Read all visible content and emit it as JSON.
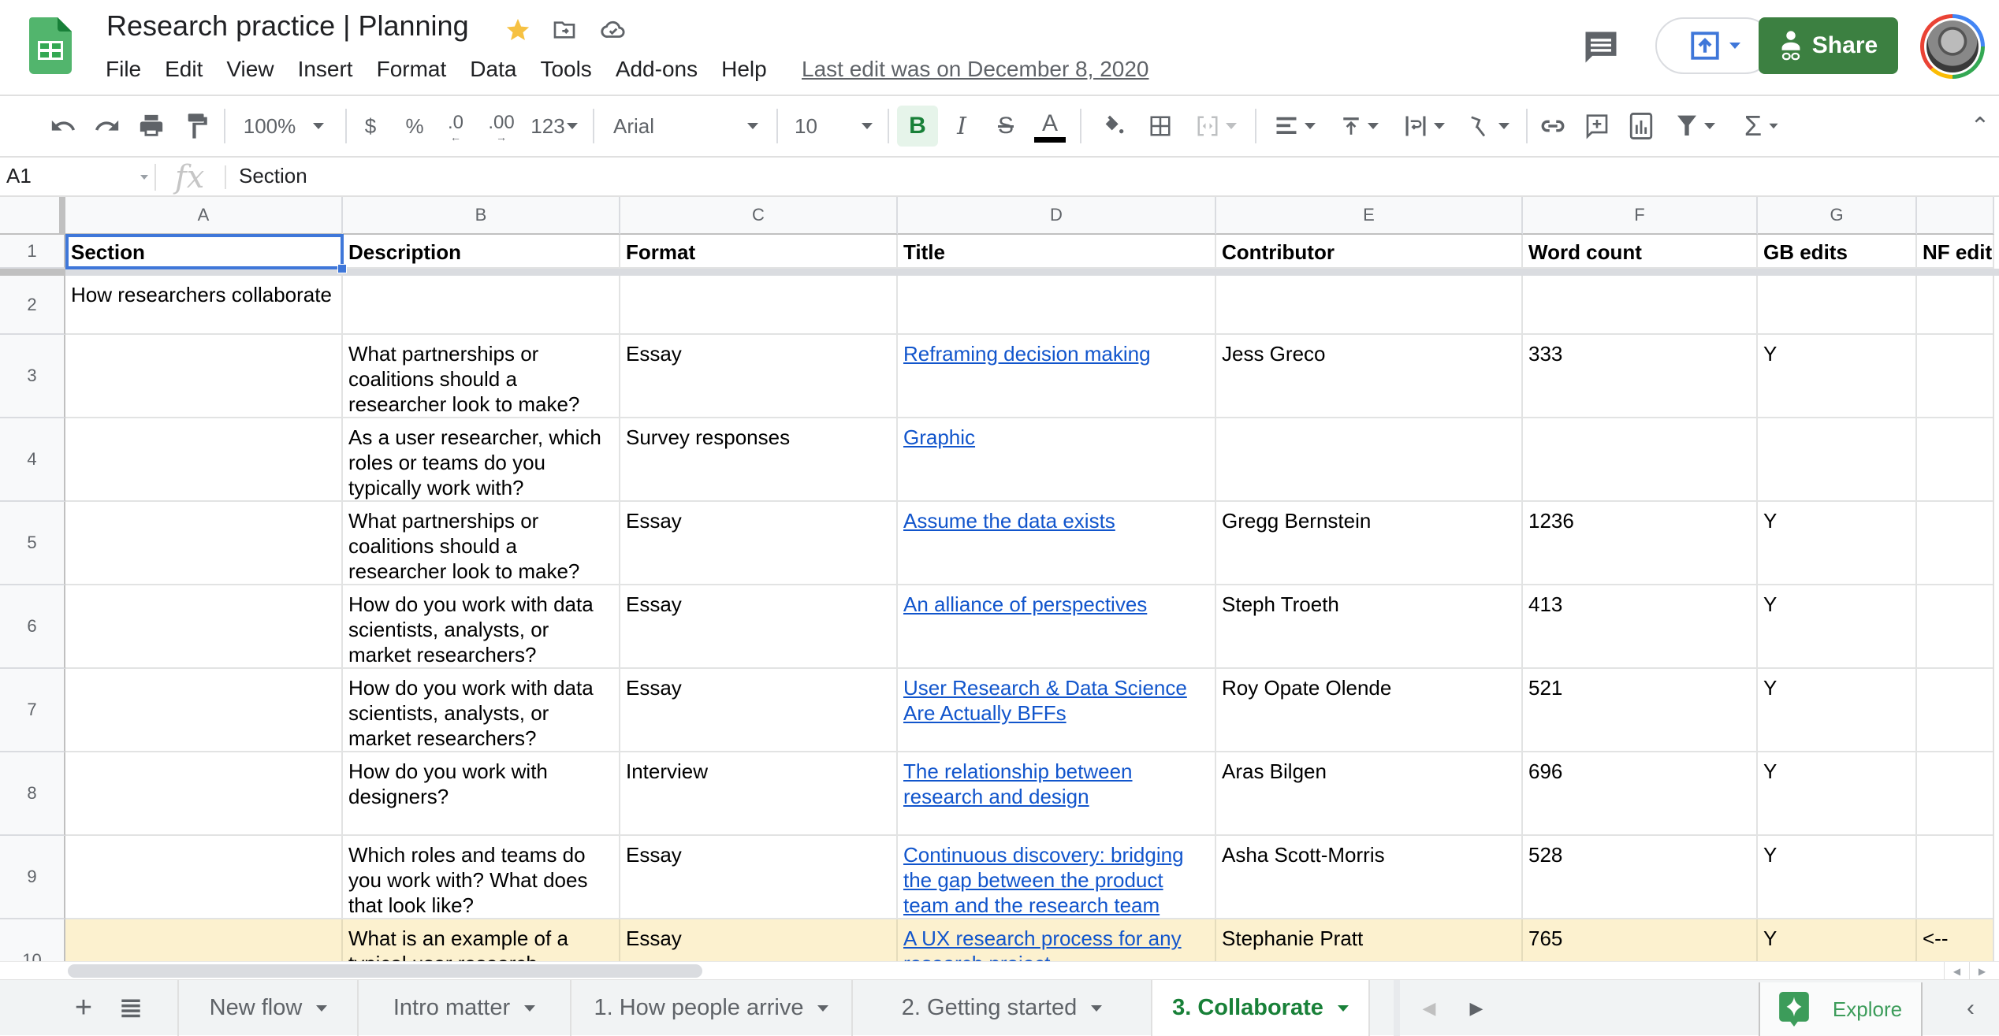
{
  "app": {
    "title": "Research practice | Planning",
    "last_edit": "Last edit was on December 8, 2020",
    "share_label": "Share",
    "colors": {
      "brand_green": "#3c8041",
      "link_blue": "#1155cc",
      "selection_blue": "#3f77d9",
      "highlight_row": "#fcf1cf",
      "active_tab_green": "#188038"
    }
  },
  "menu": [
    "File",
    "Edit",
    "View",
    "Insert",
    "Format",
    "Data",
    "Tools",
    "Add-ons",
    "Help"
  ],
  "toolbar": {
    "zoom": "100%",
    "currency": "$",
    "percent": "%",
    "decrease_decimal": ".0",
    "increase_decimal": ".00",
    "more_formats": "123",
    "font": "Arial",
    "font_size": "10",
    "bold": "B",
    "italic": "I",
    "strikethrough": "S",
    "text_color": "A"
  },
  "formula_bar": {
    "cell_ref": "A1",
    "fx": "fx",
    "value": "Section"
  },
  "grid": {
    "columns": [
      "A",
      "B",
      "C",
      "D",
      "E",
      "F",
      "G",
      ""
    ],
    "row_numbers": [
      "1",
      "2",
      "3",
      "4",
      "5",
      "6",
      "7",
      "8",
      "9",
      "10"
    ],
    "header_row": [
      "Section",
      "Description",
      "Format",
      "Title",
      "Contributor",
      "Word count",
      "GB edits",
      "NF edit"
    ],
    "rows": [
      {
        "section": "How researchers collaborate",
        "description": "",
        "format": "",
        "title": "",
        "contributor": "",
        "word_count": "",
        "gb_edits": "",
        "nf_edits": ""
      },
      {
        "section": "",
        "description": "What partnerships or coalitions should a researcher look to make?",
        "format": "Essay",
        "title": "Reframing decision making",
        "contributor": "Jess Greco",
        "word_count": "333",
        "gb_edits": "Y",
        "nf_edits": ""
      },
      {
        "section": "",
        "description": "As a user researcher, which roles or teams do you typically work with?",
        "format": "Survey responses",
        "title": "Graphic",
        "contributor": "",
        "word_count": "",
        "gb_edits": "",
        "nf_edits": ""
      },
      {
        "section": "",
        "description": "What partnerships or coalitions should a researcher look to make?",
        "format": "Essay",
        "title": "Assume the data exists",
        "contributor": "Gregg Bernstein",
        "word_count": "1236",
        "gb_edits": "Y",
        "nf_edits": ""
      },
      {
        "section": "",
        "description": "How do you work with data scientists, analysts, or market researchers?",
        "format": "Essay",
        "title": "An alliance of perspectives",
        "contributor": "Steph Troeth",
        "word_count": "413",
        "gb_edits": "Y",
        "nf_edits": ""
      },
      {
        "section": "",
        "description": "How do you work with data scientists, analysts, or market researchers?",
        "format": "Essay",
        "title": "User Research & Data Science Are Actually BFFs",
        "contributor": "Roy Opate Olende",
        "word_count": "521",
        "gb_edits": "Y",
        "nf_edits": ""
      },
      {
        "section": "",
        "description": "How do you work with designers?",
        "format": "Interview",
        "title": "The relationship between research and design",
        "contributor": "Aras Bilgen",
        "word_count": "696",
        "gb_edits": "Y",
        "nf_edits": ""
      },
      {
        "section": "",
        "description": "Which roles and teams do you work with? What does that look like?",
        "format": "Essay",
        "title": "Continuous discovery: bridging the gap between the product team and the research team",
        "contributor": "Asha Scott-Morris",
        "word_count": "528",
        "gb_edits": "Y",
        "nf_edits": ""
      },
      {
        "section": "",
        "description": "What is an example of a typical user research",
        "format": "Essay",
        "title": "A UX research process for any research project",
        "contributor": "Stephanie Pratt",
        "word_count": "765",
        "gb_edits": "Y",
        "nf_edits": "<--",
        "highlighted": true
      }
    ]
  },
  "sheet_tabs": [
    {
      "label": "New flow",
      "active": false
    },
    {
      "label": "Intro matter",
      "active": false
    },
    {
      "label": "1. How people arrive",
      "active": false
    },
    {
      "label": "2. Getting started",
      "active": false
    },
    {
      "label": "3. Collaborate",
      "active": true
    }
  ],
  "explore_label": "Explore"
}
